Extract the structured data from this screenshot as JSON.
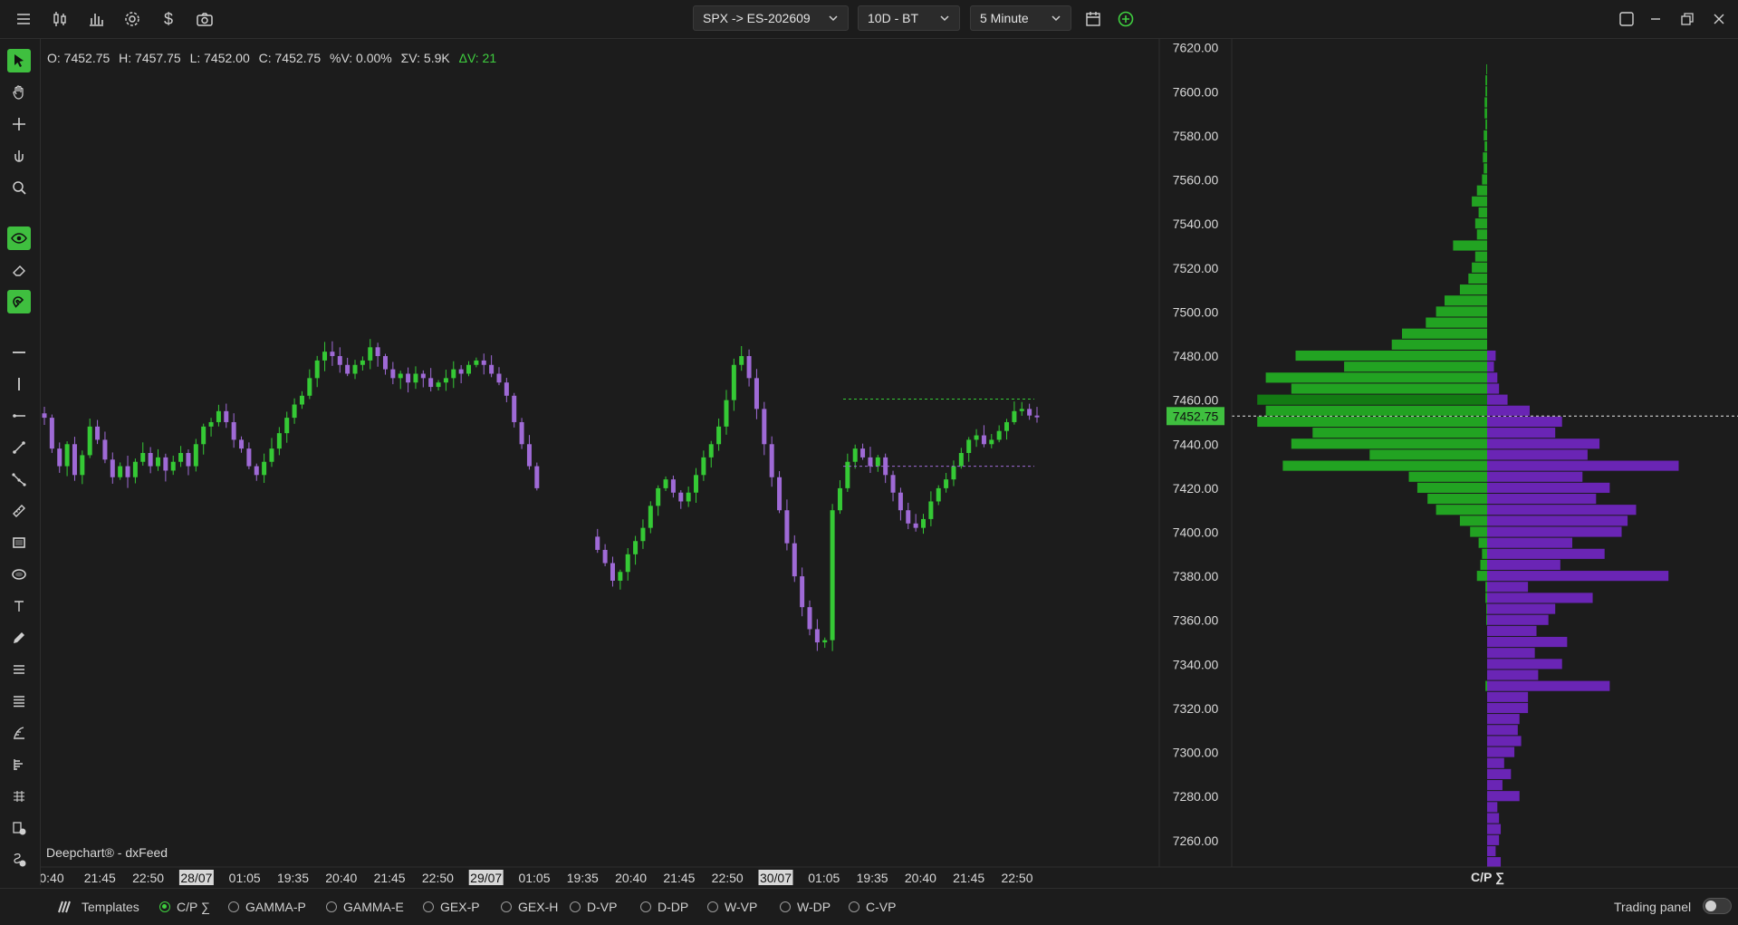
{
  "toolbar": {
    "symbol_dropdown": "SPX -> ES-202609",
    "range_dropdown": "10D - BT",
    "interval_dropdown": "5 Minute"
  },
  "ohlc": {
    "open": "O: 7452.75",
    "high": "H: 7457.75",
    "low": "L: 7452.00",
    "close": "C: 7452.75",
    "pct_vol": "%V: 0.00%",
    "sum_vol": "ΣV: 5.9K",
    "delta_vol": "ΔV: 21"
  },
  "watermark": "Deepchart® - dxFeed",
  "profile_label": "C/P ∑",
  "colors": {
    "up": "#35c935",
    "down": "#9f6ad6",
    "bid": "#22a322",
    "ask": "#6a25b5",
    "accent": "#3fbf3f"
  },
  "price_axis": {
    "ticks": [
      "7620.00",
      "7600.00",
      "7580.00",
      "7560.00",
      "7540.00",
      "7520.00",
      "7500.00",
      "7480.00",
      "7460.00",
      "7440.00",
      "7420.00",
      "7400.00",
      "7380.00",
      "7360.00",
      "7340.00",
      "7320.00",
      "7300.00",
      "7280.00",
      "7260.00"
    ],
    "current_price": "7452.75"
  },
  "time_axis": {
    "labels": [
      {
        "text": "0:40",
        "hl": false
      },
      {
        "text": "21:45",
        "hl": false
      },
      {
        "text": "22:50",
        "hl": false
      },
      {
        "text": "28/07",
        "hl": true
      },
      {
        "text": "01:05",
        "hl": false
      },
      {
        "text": "19:35",
        "hl": false
      },
      {
        "text": "20:40",
        "hl": false
      },
      {
        "text": "21:45",
        "hl": false
      },
      {
        "text": "22:50",
        "hl": false
      },
      {
        "text": "29/07",
        "hl": true
      },
      {
        "text": "01:05",
        "hl": false
      },
      {
        "text": "19:35",
        "hl": false
      },
      {
        "text": "20:40",
        "hl": false
      },
      {
        "text": "21:45",
        "hl": false
      },
      {
        "text": "22:50",
        "hl": false
      },
      {
        "text": "30/07",
        "hl": true
      },
      {
        "text": "01:05",
        "hl": false
      },
      {
        "text": "19:35",
        "hl": false
      },
      {
        "text": "20:40",
        "hl": false
      },
      {
        "text": "21:45",
        "hl": false
      },
      {
        "text": "22:50",
        "hl": false
      }
    ]
  },
  "chart_data": {
    "type": "candlestick",
    "price_range": [
      7248,
      7624
    ],
    "current_price": 7452.75,
    "lines": [
      {
        "price": 7460.5,
        "color": "#35c935",
        "style": "dashed"
      },
      {
        "price": 7430.0,
        "color": "#9f6ad6",
        "style": "dashed"
      }
    ],
    "closes": [
      7452,
      7438,
      7430,
      7440,
      7426,
      7435,
      7448,
      7442,
      7433,
      7425,
      7430,
      7425,
      7432,
      7436,
      7430,
      7434,
      7428,
      7432,
      7436,
      7430,
      7440,
      7448,
      7450,
      7455,
      7450,
      7442,
      7438,
      7430,
      7426,
      7432,
      7438,
      7445,
      7452,
      7458,
      7462,
      7470,
      7478,
      7482,
      7480,
      7476,
      7472,
      7476,
      7478,
      7484,
      7480,
      7474,
      7470,
      7472,
      7468,
      7472,
      7470,
      7466,
      7468,
      7470,
      7474,
      7472,
      7476,
      7478,
      7476,
      7472,
      7468,
      7462,
      7450,
      7440,
      7430,
      7420,
      7412,
      7406,
      7408,
      7410,
      7404,
      7402,
      7398,
      7392,
      7386,
      7378,
      7382,
      7390,
      7396,
      7402,
      7412,
      7420,
      7424,
      7418,
      7414,
      7418,
      7426,
      7434,
      7440,
      7448,
      7460,
      7476,
      7480,
      7470,
      7456,
      7440,
      7425,
      7410,
      7395,
      7380,
      7366,
      7356,
      7350,
      7351,
      7410,
      7420,
      7432,
      7438,
      7434,
      7430,
      7434,
      7426,
      7418,
      7410,
      7404,
      7402,
      7406,
      7414,
      7420,
      7424,
      7430,
      7436,
      7442,
      7444,
      7440,
      7442,
      7446,
      7450,
      7455,
      7456,
      7453,
      7452.75
    ],
    "profile": [
      {
        "price": 7610,
        "bid": 1,
        "ask": 0
      },
      {
        "price": 7605,
        "bid": 2,
        "ask": 0
      },
      {
        "price": 7600,
        "bid": 2,
        "ask": 0
      },
      {
        "price": 7595,
        "bid": 3,
        "ask": 0
      },
      {
        "price": 7590,
        "bid": 3,
        "ask": 0
      },
      {
        "price": 7585,
        "bid": 2,
        "ask": 0
      },
      {
        "price": 7580,
        "bid": 4,
        "ask": 0
      },
      {
        "price": 7575,
        "bid": 3,
        "ask": 0
      },
      {
        "price": 7570,
        "bid": 5,
        "ask": 0
      },
      {
        "price": 7565,
        "bid": 4,
        "ask": 0
      },
      {
        "price": 7560,
        "bid": 6,
        "ask": 0
      },
      {
        "price": 7555,
        "bid": 12,
        "ask": 0
      },
      {
        "price": 7550,
        "bid": 18,
        "ask": 0
      },
      {
        "price": 7545,
        "bid": 10,
        "ask": 0
      },
      {
        "price": 7540,
        "bid": 14,
        "ask": 0
      },
      {
        "price": 7535,
        "bid": 12,
        "ask": 0
      },
      {
        "price": 7530,
        "bid": 40,
        "ask": 0
      },
      {
        "price": 7525,
        "bid": 14,
        "ask": 0
      },
      {
        "price": 7520,
        "bid": 18,
        "ask": 0
      },
      {
        "price": 7515,
        "bid": 22,
        "ask": 0
      },
      {
        "price": 7510,
        "bid": 32,
        "ask": 0
      },
      {
        "price": 7505,
        "bid": 50,
        "ask": 0
      },
      {
        "price": 7500,
        "bid": 60,
        "ask": 0
      },
      {
        "price": 7495,
        "bid": 72,
        "ask": 0
      },
      {
        "price": 7490,
        "bid": 100,
        "ask": 0
      },
      {
        "price": 7485,
        "bid": 112,
        "ask": 0
      },
      {
        "price": 7480,
        "bid": 225,
        "ask": 10
      },
      {
        "price": 7475,
        "bid": 168,
        "ask": 8
      },
      {
        "price": 7470,
        "bid": 260,
        "ask": 12
      },
      {
        "price": 7465,
        "bid": 230,
        "ask": 14
      },
      {
        "price": 7460,
        "bid": 270,
        "ask": 24
      },
      {
        "price": 7455,
        "bid": 260,
        "ask": 50
      },
      {
        "price": 7450,
        "bid": 270,
        "ask": 88
      },
      {
        "price": 7445,
        "bid": 205,
        "ask": 80
      },
      {
        "price": 7440,
        "bid": 230,
        "ask": 132
      },
      {
        "price": 7435,
        "bid": 138,
        "ask": 118
      },
      {
        "price": 7430,
        "bid": 240,
        "ask": 225
      },
      {
        "price": 7425,
        "bid": 92,
        "ask": 112
      },
      {
        "price": 7420,
        "bid": 82,
        "ask": 144
      },
      {
        "price": 7415,
        "bid": 70,
        "ask": 128
      },
      {
        "price": 7410,
        "bid": 60,
        "ask": 175
      },
      {
        "price": 7405,
        "bid": 32,
        "ask": 165
      },
      {
        "price": 7400,
        "bid": 20,
        "ask": 158
      },
      {
        "price": 7395,
        "bid": 10,
        "ask": 100
      },
      {
        "price": 7390,
        "bid": 6,
        "ask": 138
      },
      {
        "price": 7385,
        "bid": 8,
        "ask": 86
      },
      {
        "price": 7380,
        "bid": 12,
        "ask": 213
      },
      {
        "price": 7375,
        "bid": 2,
        "ask": 48
      },
      {
        "price": 7370,
        "bid": 2,
        "ask": 124
      },
      {
        "price": 7365,
        "bid": 1,
        "ask": 80
      },
      {
        "price": 7360,
        "bid": 1,
        "ask": 72
      },
      {
        "price": 7355,
        "bid": 0,
        "ask": 58
      },
      {
        "price": 7350,
        "bid": 0,
        "ask": 94
      },
      {
        "price": 7345,
        "bid": 0,
        "ask": 56
      },
      {
        "price": 7340,
        "bid": 0,
        "ask": 88
      },
      {
        "price": 7335,
        "bid": 0,
        "ask": 60
      },
      {
        "price": 7330,
        "bid": 2,
        "ask": 144
      },
      {
        "price": 7325,
        "bid": 0,
        "ask": 48
      },
      {
        "price": 7320,
        "bid": 0,
        "ask": 48
      },
      {
        "price": 7315,
        "bid": 0,
        "ask": 38
      },
      {
        "price": 7310,
        "bid": 0,
        "ask": 36
      },
      {
        "price": 7305,
        "bid": 0,
        "ask": 40
      },
      {
        "price": 7300,
        "bid": 0,
        "ask": 32
      },
      {
        "price": 7295,
        "bid": 0,
        "ask": 20
      },
      {
        "price": 7290,
        "bid": 0,
        "ask": 28
      },
      {
        "price": 7285,
        "bid": 0,
        "ask": 18
      },
      {
        "price": 7280,
        "bid": 0,
        "ask": 38
      },
      {
        "price": 7275,
        "bid": 0,
        "ask": 12
      },
      {
        "price": 7270,
        "bid": 0,
        "ask": 14
      },
      {
        "price": 7265,
        "bid": 0,
        "ask": 16
      },
      {
        "price": 7260,
        "bid": 0,
        "ask": 14
      },
      {
        "price": 7255,
        "bid": 0,
        "ask": 10
      },
      {
        "price": 7250,
        "bid": 0,
        "ask": 16
      }
    ]
  },
  "bottom": {
    "templates": "Templates",
    "tabs": [
      {
        "label": "C/P ∑",
        "on": true
      },
      {
        "label": "GAMMA-P",
        "on": false
      },
      {
        "label": "GAMMA-E",
        "on": false
      },
      {
        "label": "GEX-P",
        "on": false
      },
      {
        "label": "GEX-H",
        "on": false
      },
      {
        "label": "D-VP",
        "on": false
      },
      {
        "label": "D-DP",
        "on": false
      },
      {
        "label": "W-VP",
        "on": false
      },
      {
        "label": "W-DP",
        "on": false
      },
      {
        "label": "C-VP",
        "on": false
      }
    ],
    "trading_panel": "Trading panel"
  }
}
